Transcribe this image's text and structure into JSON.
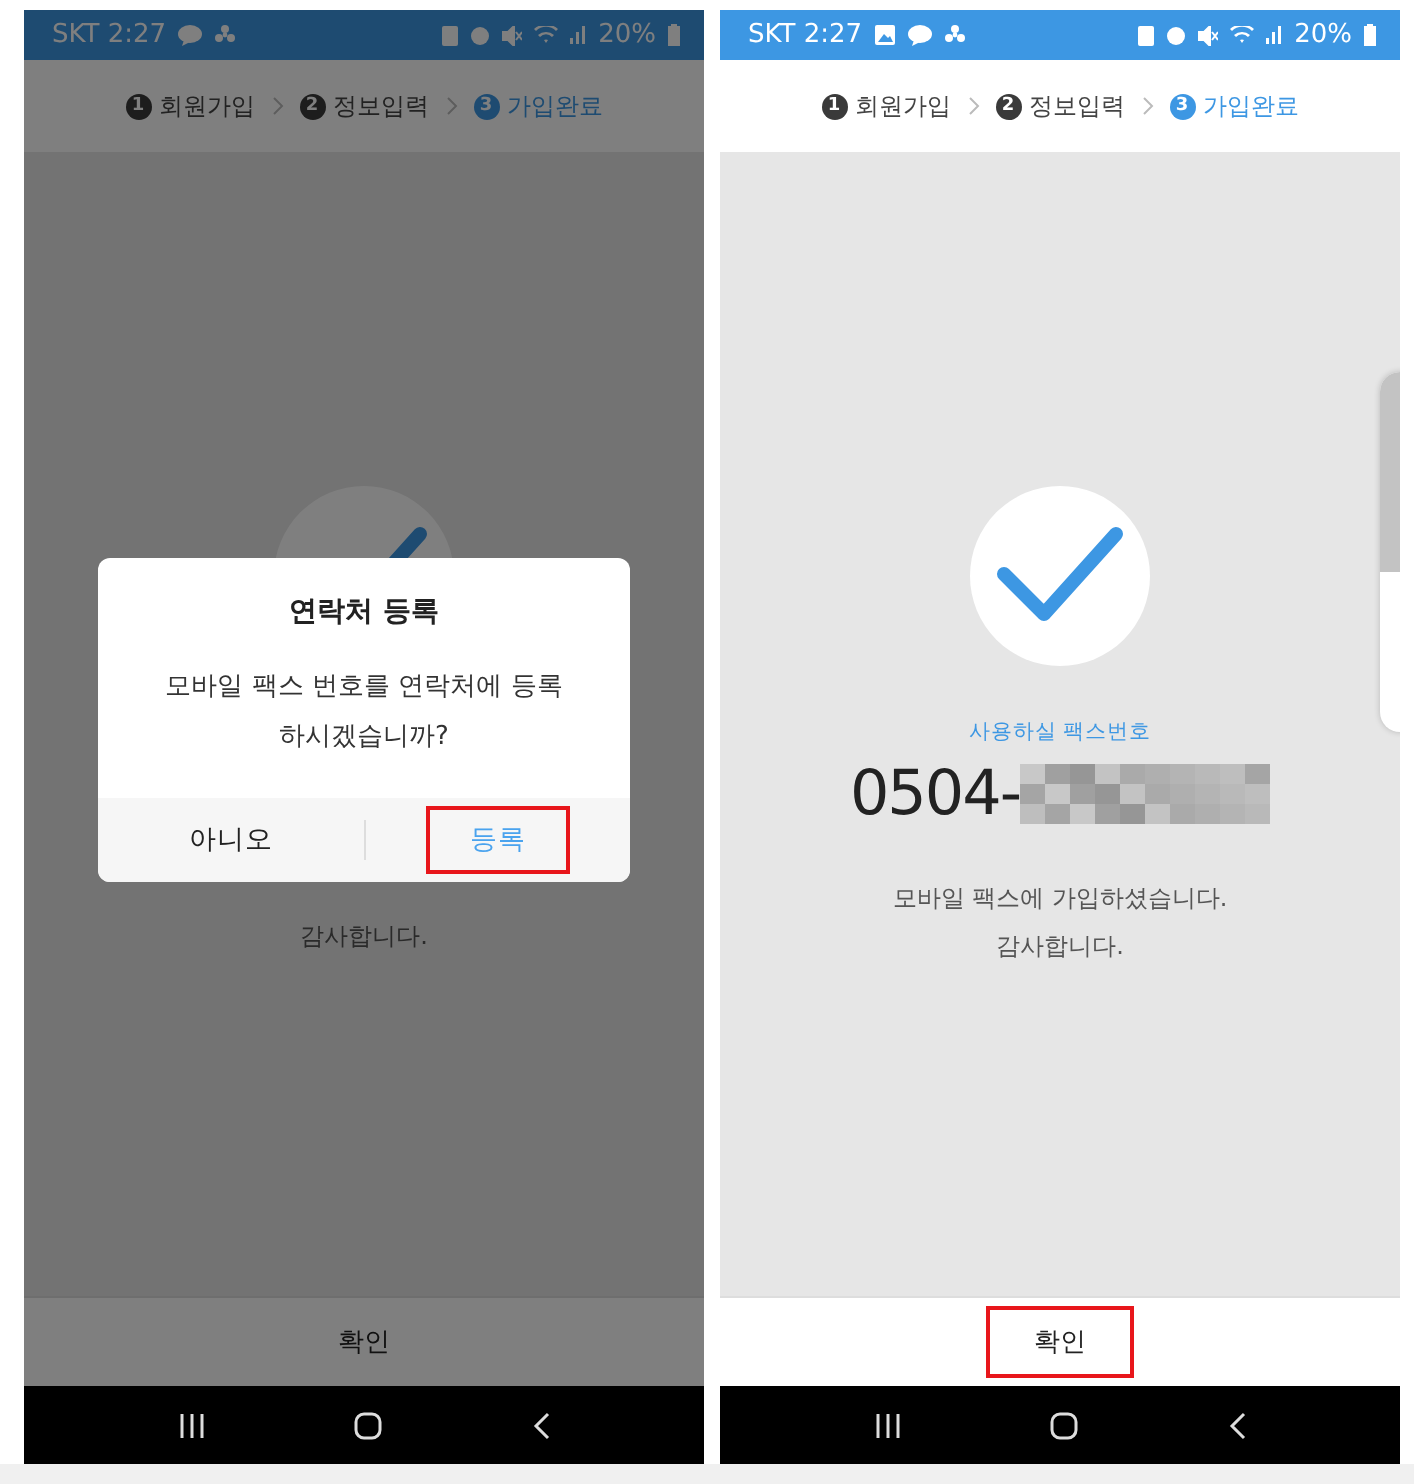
{
  "phones": [
    {
      "status_bar": {
        "time": "SKT 2:27",
        "notifications": [
          {
            "kind": "chat"
          },
          {
            "kind": "pinwheel"
          }
        ],
        "battery": "20%"
      },
      "steps": [
        {
          "number": "1",
          "label": "회원가입",
          "selected": false
        },
        {
          "number": "2",
          "label": "정보입력",
          "selected": false
        },
        {
          "number": "3",
          "label": "가입완료",
          "selected": true
        }
      ],
      "message": [
        "감사합니다."
      ],
      "confirm_button": {
        "label": "확인",
        "highlighted": false
      },
      "dialog": {
        "title": "연락처 등록",
        "body": "모바일 팩스 번호를 연락처에 등록 하시겠습니까?",
        "buttons": [
          {
            "label": "아니오",
            "primary": false,
            "highlighted": false
          },
          {
            "label": "등록",
            "primary": true,
            "highlighted": true
          }
        ]
      }
    },
    {
      "status_bar": {
        "time": "SKT 2:27",
        "notifications": [
          {
            "kind": "image"
          },
          {
            "kind": "chat"
          },
          {
            "kind": "pinwheel"
          }
        ],
        "battery": "20%"
      },
      "steps": [
        {
          "number": "1",
          "label": "회원가입",
          "selected": false
        },
        {
          "number": "2",
          "label": "정보입력",
          "selected": false
        },
        {
          "number": "3",
          "label": "가입완료",
          "selected": true
        }
      ],
      "fax_label": "사용하실 팩스번호",
      "fax_number": "0504-",
      "message": [
        "모바일 팩스에 가입하셨습니다.",
        "감사합니다."
      ],
      "confirm_button": {
        "label": "확인",
        "highlighted": true
      },
      "side_widget": true
    }
  ]
}
